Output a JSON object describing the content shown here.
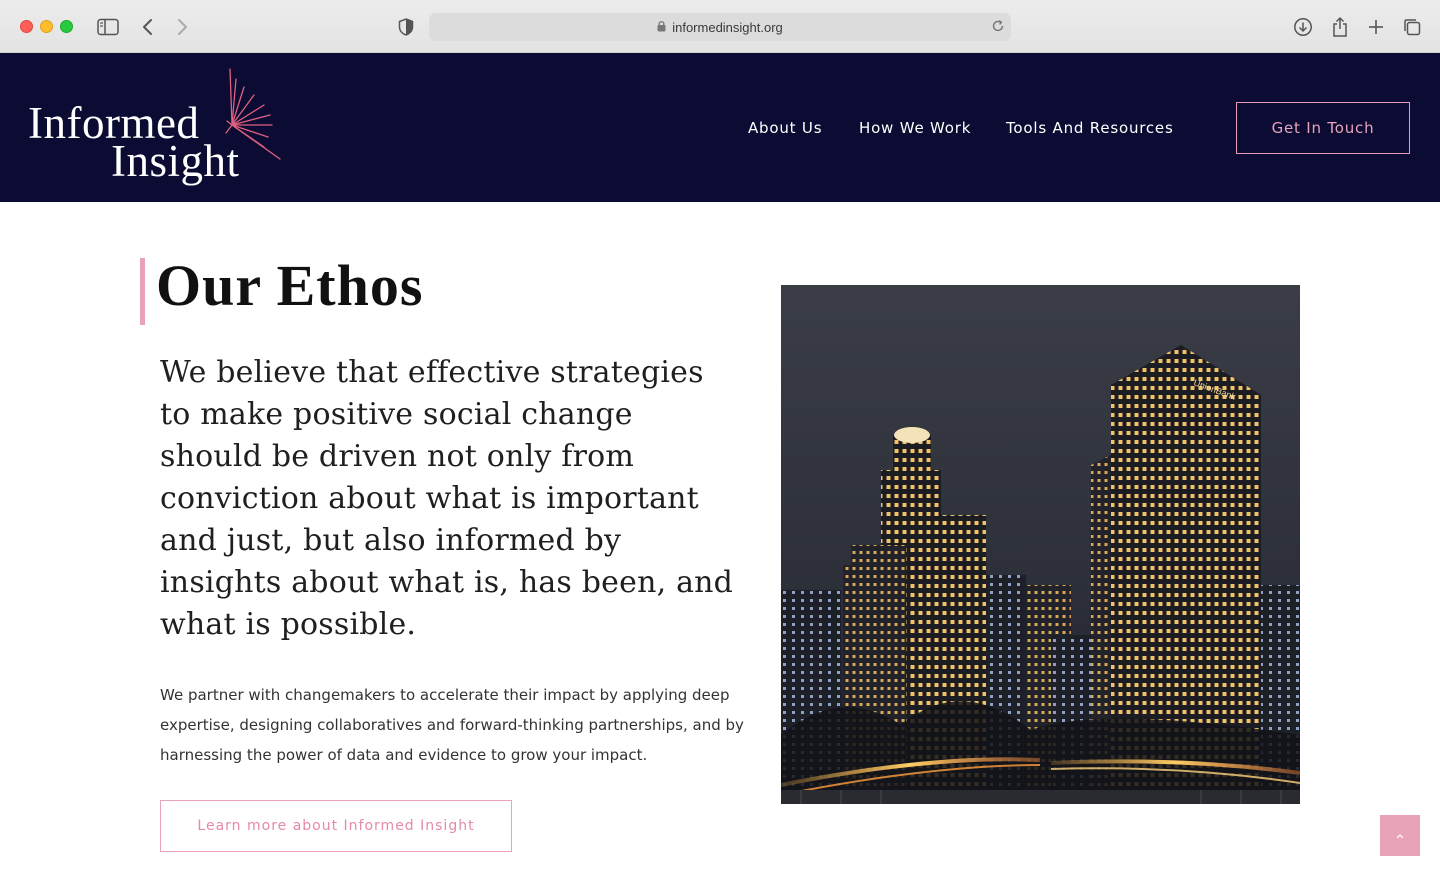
{
  "browser": {
    "url": "informedinsight.org"
  },
  "site": {
    "logo": {
      "line1": "Informed",
      "line2": "Insight"
    },
    "nav": [
      {
        "label": "About Us"
      },
      {
        "label": "How We Work"
      },
      {
        "label": "Tools And Resources"
      }
    ],
    "cta_label": "Get In Touch"
  },
  "main": {
    "heading": "Our Ethos",
    "lead": "We believe that effective strategies to make positive social change should be driven not only from conviction about what is important and just, but also informed by insights about what is, has been, and what is possible.",
    "body": "We partner with changemakers to accelerate their impact by applying deep expertise, designing collaboratives and forward-thinking partnerships, and by harnessing the power of data and evidence to grow your impact.",
    "learn_more_label": "Learn more about Informed Insight",
    "photo_sign": "UnionBank"
  },
  "colors": {
    "header_bg": "#0b0b33",
    "accent_pink": "#e9a3b6"
  },
  "icons": [
    "sidebar-icon",
    "back-icon",
    "forward-icon",
    "shield-icon",
    "lock-icon",
    "reload-icon",
    "download-icon",
    "share-icon",
    "new-tab-icon",
    "tabs-icon",
    "chevron-up-icon"
  ]
}
